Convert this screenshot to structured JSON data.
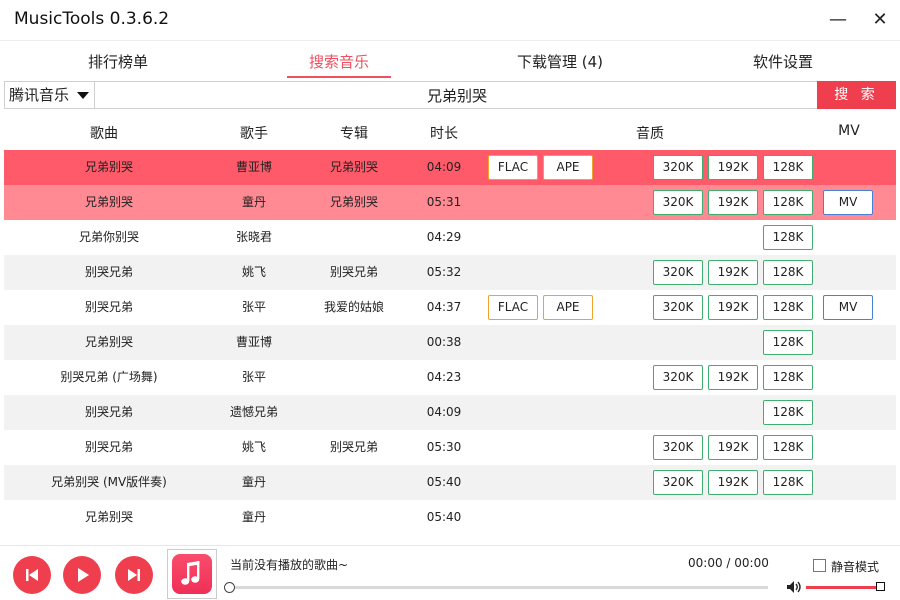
{
  "window": {
    "title": "MusicTools 0.3.6.2",
    "minimize_glyph": "—",
    "close_glyph": "✕"
  },
  "tabs": [
    {
      "label": "排行榜单"
    },
    {
      "label": "搜索音乐",
      "active": true
    },
    {
      "label": "下载管理 (4)"
    },
    {
      "label": "软件设置"
    }
  ],
  "search": {
    "source": "腾讯音乐",
    "query": "兄弟别哭",
    "button_label": "搜 索"
  },
  "table": {
    "columns": {
      "song": "歌曲",
      "artist": "歌手",
      "album": "专辑",
      "duration": "时长",
      "quality": "音质",
      "mv": "MV"
    },
    "rows": [
      {
        "song": "兄弟别哭",
        "artist": "曹亚博",
        "album": "兄弟别哭",
        "duration": "04:09",
        "lossless": [
          "FLAC",
          "APE"
        ],
        "bitrates": [
          "320K",
          "192K",
          "128K"
        ],
        "mv": "",
        "highlight": "#ff5a6a"
      },
      {
        "song": "兄弟别哭",
        "artist": "童丹",
        "album": "兄弟别哭",
        "duration": "05:31",
        "lossless": [],
        "bitrates": [
          "320K",
          "192K",
          "128K"
        ],
        "mv": "MV",
        "highlight": "#ff8a93"
      },
      {
        "song": "兄弟你别哭",
        "artist": "张晓君",
        "album": "",
        "duration": "04:29",
        "lossless": [],
        "bitrates": [
          "128K"
        ],
        "mv": "",
        "highlight": "#ffffff"
      },
      {
        "song": "别哭兄弟",
        "artist": "姚飞",
        "album": "别哭兄弟",
        "duration": "05:32",
        "lossless": [],
        "bitrates": [
          "320K",
          "192K",
          "128K"
        ],
        "mv": "",
        "highlight": "#f2f2f2"
      },
      {
        "song": "别哭兄弟",
        "artist": "张平",
        "album": "我爱的姑娘",
        "duration": "04:37",
        "lossless": [
          "FLAC",
          "APE"
        ],
        "bitrates": [
          "320K",
          "192K",
          "128K"
        ],
        "mv": "MV",
        "highlight": "#ffffff"
      },
      {
        "song": "兄弟别哭",
        "artist": "曹亚博",
        "album": "",
        "duration": "00:38",
        "lossless": [],
        "bitrates": [
          "128K"
        ],
        "mv": "",
        "highlight": "#f2f2f2"
      },
      {
        "song": "别哭兄弟 (广场舞)",
        "artist": "张平",
        "album": "",
        "duration": "04:23",
        "lossless": [],
        "bitrates": [
          "320K",
          "192K",
          "128K"
        ],
        "mv": "",
        "highlight": "#ffffff"
      },
      {
        "song": "别哭兄弟",
        "artist": "遗憾兄弟",
        "album": "",
        "duration": "04:09",
        "lossless": [],
        "bitrates": [
          "128K"
        ],
        "mv": "",
        "highlight": "#f2f2f2"
      },
      {
        "song": "别哭兄弟",
        "artist": "姚飞",
        "album": "别哭兄弟",
        "duration": "05:30",
        "lossless": [],
        "bitrates": [
          "320K",
          "192K",
          "128K"
        ],
        "mv": "",
        "highlight": "#ffffff"
      },
      {
        "song": "兄弟别哭 (MV版伴奏)",
        "artist": "童丹",
        "album": "",
        "duration": "05:40",
        "lossless": [],
        "bitrates": [
          "320K",
          "192K",
          "128K"
        ],
        "mv": "",
        "highlight": "#f2f2f2"
      },
      {
        "song": "兄弟别哭",
        "artist": "童丹",
        "album": "",
        "duration": "05:40",
        "lossless": [],
        "bitrates": [],
        "mv": "",
        "highlight": "#ffffff"
      }
    ]
  },
  "player": {
    "now_playing": "当前没有播放的歌曲~",
    "time": "00:00 / 00:00",
    "mute_label": "静音模式",
    "muted": false,
    "progress": 0,
    "volume": 1.0,
    "accent": "#ef3f4f"
  }
}
